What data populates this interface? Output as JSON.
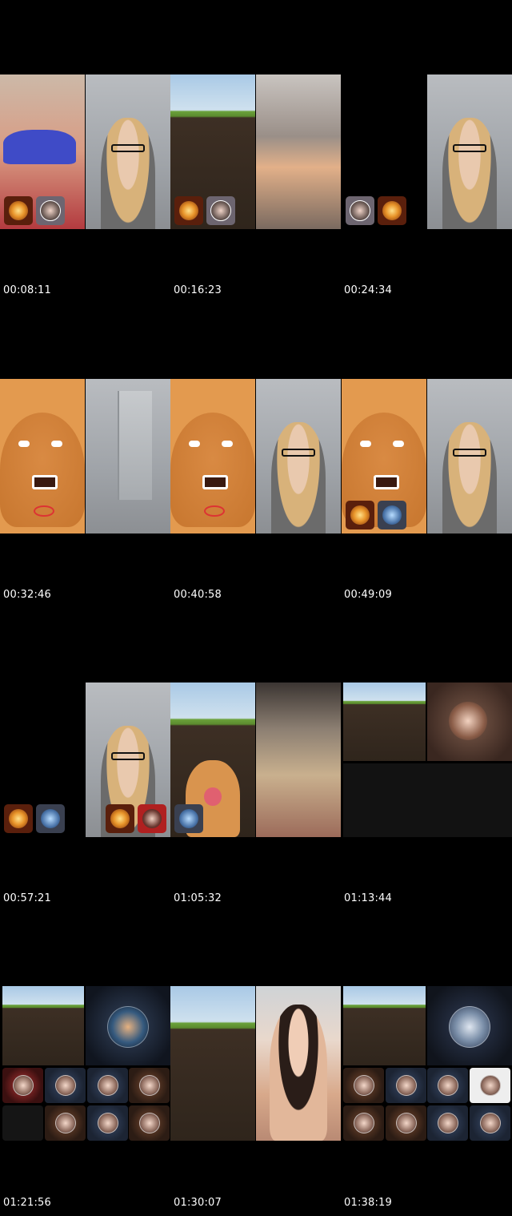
{
  "timestamps": [
    "00:08:11",
    "00:16:23",
    "00:24:34",
    "00:32:46",
    "00:40:58",
    "00:49:09",
    "00:57:21",
    "01:05:32",
    "01:13:44",
    "01:21:56",
    "01:30:07",
    "01:38:19"
  ],
  "colors": {
    "background": "#000000",
    "timestamp_text": "#ffffff"
  },
  "icons": {
    "effect_button": "fire-effect-icon",
    "profile_button": "user-avatar-icon",
    "globe_button": "globe-avatar-icon"
  }
}
